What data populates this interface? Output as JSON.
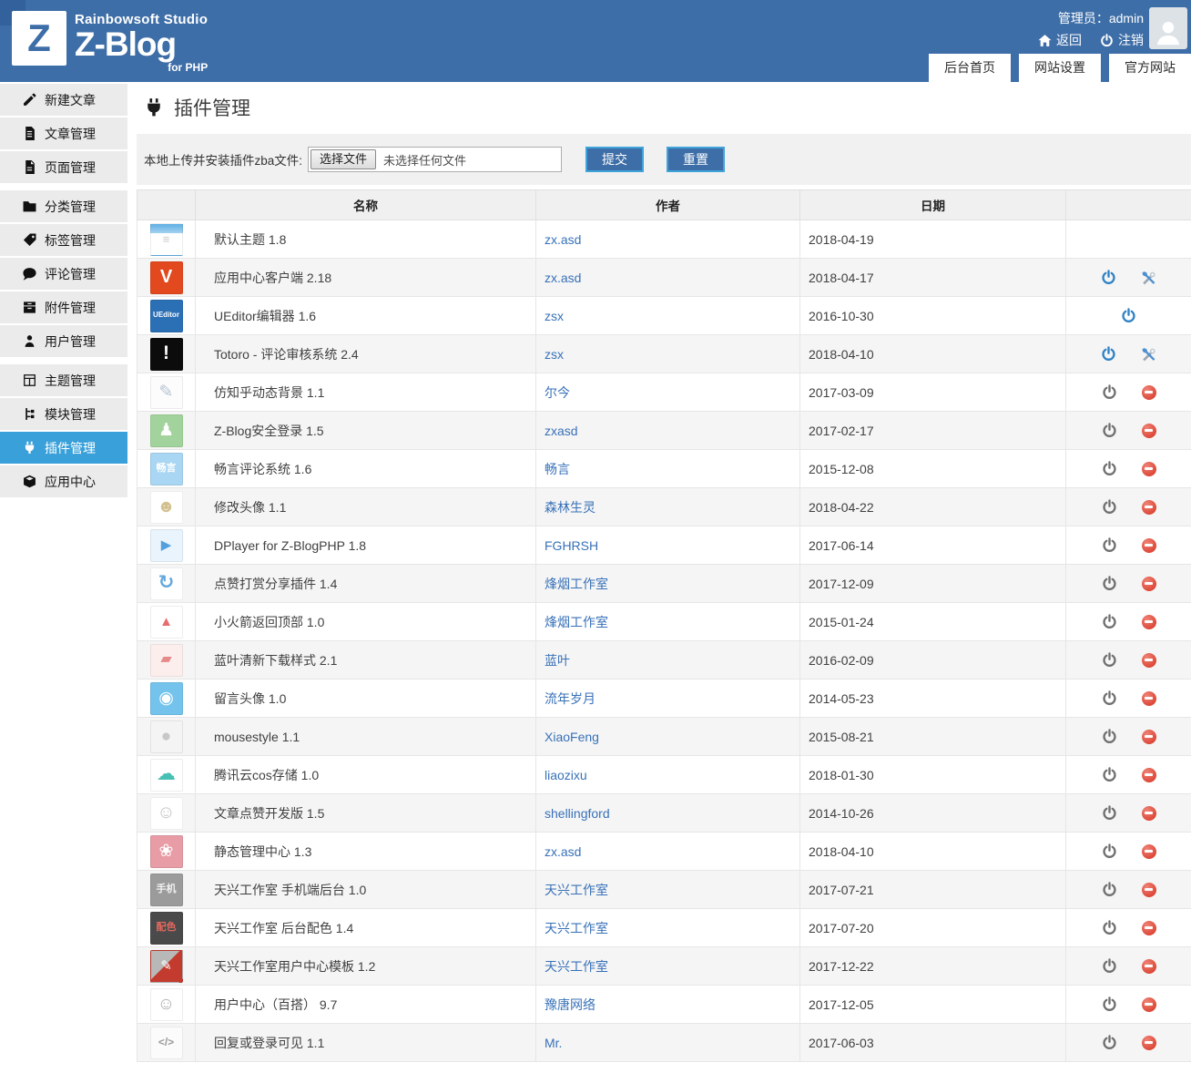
{
  "header": {
    "brand": {
      "logo_letter": "Z",
      "studio": "Rainbowsoft Studio",
      "product": "Z-Blog",
      "sub": "for PHP"
    },
    "admin_label": "管理员：admin",
    "back_label": "返回",
    "logout_label": "注销",
    "tabs": [
      {
        "label": "后台首页"
      },
      {
        "label": "网站设置"
      },
      {
        "label": "官方网站"
      }
    ]
  },
  "colors": {
    "header_blue": "#3e6ea7",
    "active_sidebar_blue": "#3aa0d9",
    "link_blue": "#3871b8",
    "button_border_blue": "#3fa4da",
    "enabled_icon_blue": "#2d82c6",
    "delete_red": "#dc4535"
  },
  "sidebar": {
    "items": [
      {
        "label": "新建文章",
        "icon": "new-post",
        "active": false,
        "gap_before": false
      },
      {
        "label": "文章管理",
        "icon": "post-mgmt",
        "active": false,
        "gap_before": false
      },
      {
        "label": "页面管理",
        "icon": "page-mgmt",
        "active": false,
        "gap_before": false
      },
      {
        "label": "分类管理",
        "icon": "category-mgmt",
        "active": false,
        "gap_before": true
      },
      {
        "label": "标签管理",
        "icon": "tag-mgmt",
        "active": false,
        "gap_before": false
      },
      {
        "label": "评论管理",
        "icon": "comment-mgmt",
        "active": false,
        "gap_before": false
      },
      {
        "label": "附件管理",
        "icon": "attachment-mgmt",
        "active": false,
        "gap_before": false
      },
      {
        "label": "用户管理",
        "icon": "user-mgmt",
        "active": false,
        "gap_before": false
      },
      {
        "label": "主题管理",
        "icon": "theme-mgmt",
        "active": false,
        "gap_before": true
      },
      {
        "label": "模块管理",
        "icon": "module-mgmt",
        "active": false,
        "gap_before": false
      },
      {
        "label": "插件管理",
        "icon": "plugin-mgmt",
        "active": true,
        "gap_before": false
      },
      {
        "label": "应用中心",
        "icon": "app-center",
        "active": false,
        "gap_before": false
      }
    ]
  },
  "page": {
    "title": "插件管理"
  },
  "upload": {
    "label": "本地上传并安装插件zba文件:",
    "choose_button": "选择文件",
    "no_file_text": "未选择任何文件",
    "submit_label": "提交",
    "reset_label": "重置"
  },
  "table": {
    "headers": {
      "name": "名称",
      "author": "作者",
      "date": "日期"
    },
    "rows": [
      {
        "name": "默认主题 1.8",
        "author": "zx.asd",
        "date": "2018-04-19",
        "actions": [],
        "thumb": {
          "name": "default-theme-thumb",
          "bg": "linear-gradient(180deg,#5fafe4 0%,#a6d3f0 30%,#ffffff 30%)",
          "fg": "#c9c9c9",
          "glyph": "≡",
          "size": 13
        }
      },
      {
        "name": "应用中心客户端 2.18",
        "author": "zx.asd",
        "date": "2018-04-17",
        "actions": [
          "power-on",
          "settings"
        ],
        "thumb": {
          "name": "app-center-client-thumb",
          "bg": "#e2491f",
          "fg": "#ffffff",
          "glyph": "V",
          "size": 20
        }
      },
      {
        "name": "UEditor编辑器 1.6",
        "author": "zsx",
        "date": "2016-10-30",
        "actions": [
          "power-on"
        ],
        "thumb": {
          "name": "ueditor-thumb",
          "bg": "#2b6fb5",
          "fg": "#ffffff",
          "glyph": "UEditor",
          "size": 8
        }
      },
      {
        "name": "Totoro - 评论审核系统 2.4",
        "author": "zsx",
        "date": "2018-04-10",
        "actions": [
          "power-on",
          "settings"
        ],
        "thumb": {
          "name": "totoro-thumb",
          "bg": "#0c0c0c",
          "fg": "#ffffff",
          "glyph": "!",
          "size": 21
        }
      },
      {
        "name": "仿知乎动态背景 1.1",
        "author": "尔今",
        "date": "2017-03-09",
        "actions": [
          "power-off",
          "delete"
        ],
        "thumb": {
          "name": "zhihu-bg-thumb",
          "bg": "#fcfcfc",
          "fg": "#b7c5d1",
          "glyph": "✎",
          "size": 19
        }
      },
      {
        "name": "Z-Blog安全登录 1.5",
        "author": "zxasd",
        "date": "2017-02-17",
        "actions": [
          "power-off",
          "delete"
        ],
        "thumb": {
          "name": "secure-login-thumb",
          "bg": "#a3d39c",
          "fg": "#ffffff",
          "glyph": "♟",
          "size": 19
        }
      },
      {
        "name": "畅言评论系统 1.6",
        "author": "畅言",
        "date": "2015-12-08",
        "actions": [
          "power-off",
          "delete"
        ],
        "thumb": {
          "name": "changyan-thumb",
          "bg": "#a9d6f2",
          "fg": "#ffffff",
          "glyph": "畅言",
          "size": 11
        }
      },
      {
        "name": "修改头像 1.1",
        "author": "森林生灵",
        "date": "2018-04-22",
        "actions": [
          "power-off",
          "delete"
        ],
        "thumb": {
          "name": "avatar-edit-thumb",
          "bg": "#ffffff",
          "fg": "#d3c08f",
          "glyph": "☻",
          "size": 19
        }
      },
      {
        "name": "DPlayer for Z-BlogPHP 1.8",
        "author": "FGHRSH",
        "date": "2017-06-14",
        "actions": [
          "power-off",
          "delete"
        ],
        "thumb": {
          "name": "dplayer-thumb",
          "bg": "#e9f4fc",
          "fg": "#54a0dc",
          "glyph": "▶",
          "size": 15
        }
      },
      {
        "name": "点赞打赏分享插件 1.4",
        "author": "烽烟工作室",
        "date": "2017-12-09",
        "actions": [
          "power-off",
          "delete"
        ],
        "thumb": {
          "name": "like-share-thumb",
          "bg": "#ffffff",
          "fg": "#63a8dc",
          "glyph": "↻",
          "size": 21
        }
      },
      {
        "name": "小火箭返回顶部 1.0",
        "author": "烽烟工作室",
        "date": "2015-01-24",
        "actions": [
          "power-off",
          "delete"
        ],
        "thumb": {
          "name": "rocket-top-thumb",
          "bg": "#ffffff",
          "fg": "#e66e6e",
          "glyph": "▲",
          "size": 15
        }
      },
      {
        "name": "蓝叶清新下载样式 2.1",
        "author": "蓝叶",
        "date": "2016-02-09",
        "actions": [
          "power-off",
          "delete"
        ],
        "thumb": {
          "name": "download-style-thumb",
          "bg": "#fdeeee",
          "fg": "#e58989",
          "glyph": "▰",
          "size": 16
        }
      },
      {
        "name": "留言头像 1.0",
        "author": "流年岁月",
        "date": "2014-05-23",
        "actions": [
          "power-off",
          "delete"
        ],
        "thumb": {
          "name": "comment-avatar-thumb",
          "bg": "#74c3ec",
          "fg": "#ffffff",
          "glyph": "◉",
          "size": 19
        }
      },
      {
        "name": "mousestyle 1.1",
        "author": "XiaoFeng",
        "date": "2015-08-21",
        "actions": [
          "power-off",
          "delete"
        ],
        "thumb": {
          "name": "mousestyle-thumb",
          "bg": "#f4f4f4",
          "fg": "#c7c7c7",
          "glyph": "●",
          "size": 19
        }
      },
      {
        "name": "腾讯云cos存储 1.0",
        "author": "liaozixu",
        "date": "2018-01-30",
        "actions": [
          "power-off",
          "delete"
        ],
        "thumb": {
          "name": "tencent-cos-thumb",
          "bg": "#ffffff",
          "fg": "#46c0b5",
          "glyph": "☁",
          "size": 21
        }
      },
      {
        "name": "文章点赞开发版 1.5",
        "author": "shellingford",
        "date": "2014-10-26",
        "actions": [
          "power-off",
          "delete"
        ],
        "thumb": {
          "name": "article-like-thumb",
          "bg": "#ffffff",
          "fg": "#c4c4c4",
          "glyph": "☺",
          "size": 20
        }
      },
      {
        "name": "静态管理中心 1.3",
        "author": "zx.asd",
        "date": "2018-04-10",
        "actions": [
          "power-off",
          "delete"
        ],
        "thumb": {
          "name": "static-center-thumb",
          "bg": "#e79ca6",
          "fg": "#ffffff",
          "glyph": "❀",
          "size": 19
        }
      },
      {
        "name": "天兴工作室 手机端后台 1.0",
        "author": "天兴工作室",
        "date": "2017-07-21",
        "actions": [
          "power-off",
          "delete"
        ],
        "thumb": {
          "name": "mobile-admin-thumb",
          "bg": "#9b9b9b",
          "fg": "#f0f0f0",
          "glyph": "手机",
          "size": 11
        }
      },
      {
        "name": "天兴工作室 后台配色 1.4",
        "author": "天兴工作室",
        "date": "2017-07-20",
        "actions": [
          "power-off",
          "delete"
        ],
        "thumb": {
          "name": "admin-color-thumb",
          "bg": "#4a4a4a",
          "fg": "#e0695f",
          "glyph": "配色",
          "size": 11
        }
      },
      {
        "name": "天兴工作室用户中心模板 1.2",
        "author": "天兴工作室",
        "date": "2017-12-22",
        "actions": [
          "power-off",
          "delete"
        ],
        "thumb": {
          "name": "user-center-template-thumb",
          "bg": "linear-gradient(135deg,#b8b8b8 0%,#b8b8b8 46%,#c23b2e 46%)",
          "fg": "#ffffff",
          "glyph": "✎",
          "size": 15
        }
      },
      {
        "name": "用户中心（百搭） 9.7",
        "author": "豫唐网络",
        "date": "2017-12-05",
        "actions": [
          "power-off",
          "delete"
        ],
        "thumb": {
          "name": "user-center-thumb",
          "bg": "#ffffff",
          "fg": "#b3b3b3",
          "glyph": "☺",
          "size": 19
        }
      },
      {
        "name": "回复或登录可见 1.1",
        "author": "Mr.",
        "date": "2017-06-03",
        "actions": [
          "power-off",
          "delete"
        ],
        "thumb": {
          "name": "reply-visible-thumb",
          "bg": "#fbfbfb",
          "fg": "#9a9a9a",
          "glyph": "</>",
          "size": 12
        }
      }
    ]
  }
}
